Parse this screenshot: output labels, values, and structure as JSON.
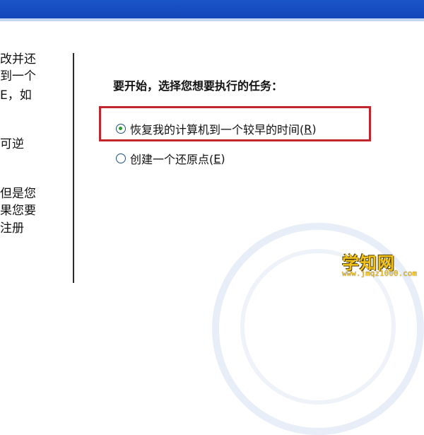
{
  "left_pane": {
    "lines": [
      "改并还",
      "到一个",
      "E，如",
      "可逆",
      "但是您",
      "果您要",
      "注册"
    ]
  },
  "task_prompt": "要开始，选择您想要执行的任务：",
  "options": [
    {
      "label": "恢复我的计算机到一个较早的时间(",
      "accesskey": "R",
      "suffix": ")",
      "checked": true
    },
    {
      "label": "创建一个还原点(",
      "accesskey": "E",
      "suffix": ")",
      "checked": false
    }
  ],
  "watermark": {
    "site_name": "学知网",
    "url": "www.jmqz1000.com"
  },
  "colors": {
    "title_bar": "#1a55c9",
    "highlight_box": "#c0262b",
    "radio_dot": "#2a9a2a"
  }
}
